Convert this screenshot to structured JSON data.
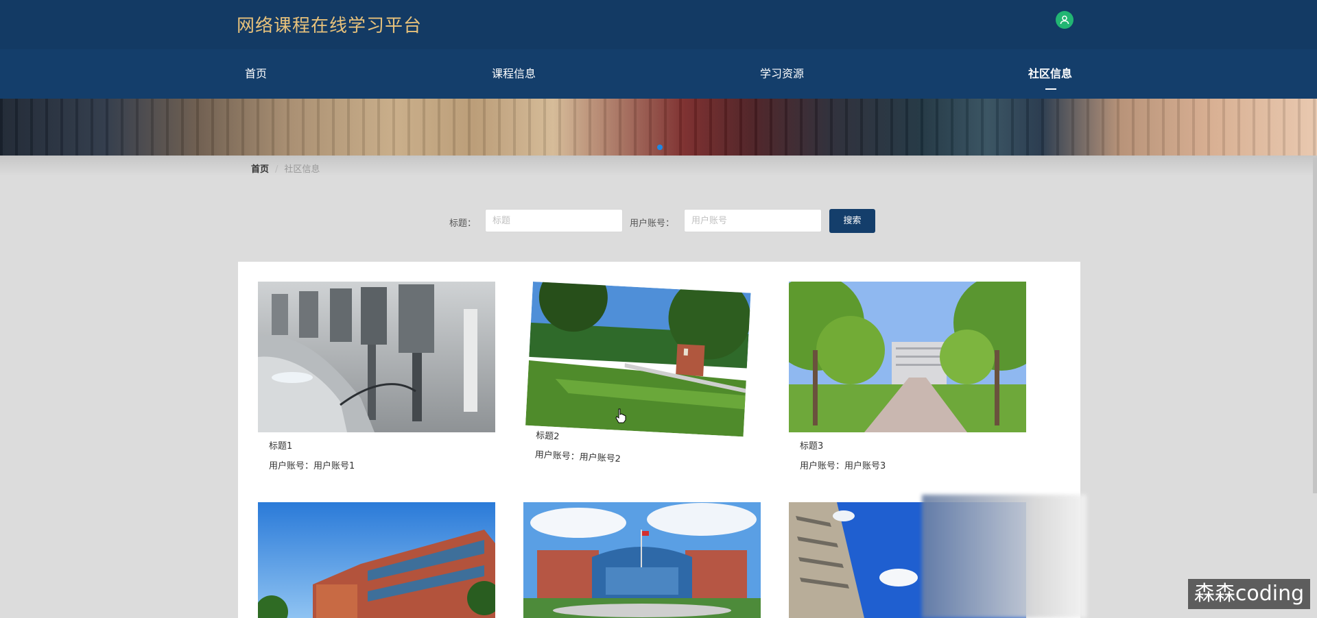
{
  "header": {
    "site_title": "网络课程在线学习平台"
  },
  "nav": {
    "items": [
      {
        "label": "首页"
      },
      {
        "label": "课程信息"
      },
      {
        "label": "学习资源"
      },
      {
        "label": "社区信息"
      }
    ],
    "active": "社区信息"
  },
  "breadcrumb": {
    "home": "首页",
    "separator": "/",
    "current": "社区信息"
  },
  "search": {
    "title_label": "标题：",
    "title_placeholder": "标题",
    "account_label": "用户账号：",
    "account_placeholder": "用户账号",
    "button_label": "搜索"
  },
  "cards": [
    {
      "title": "标题1",
      "account": "用户账号：用户账号1",
      "image": "electric-car-charging-photo"
    },
    {
      "title": "标题2",
      "account": "用户账号：用户账号2",
      "image": "campus-lawn-photo"
    },
    {
      "title": "标题3",
      "account": "用户账号：用户账号3",
      "image": "tree-lined-campus-road-photo"
    },
    {
      "title": "",
      "account": "",
      "image": "red-brick-building-photo"
    },
    {
      "title": "",
      "account": "",
      "image": "campus-gate-building-photo"
    },
    {
      "title": "",
      "account": "",
      "image": "building-blue-sky-photo"
    }
  ],
  "watermark": "森森coding",
  "colors": {
    "header": "#133a64",
    "nav": "#143e6b",
    "title": "#e8c27b",
    "button": "#143e6b",
    "avatar": "#22b573"
  }
}
